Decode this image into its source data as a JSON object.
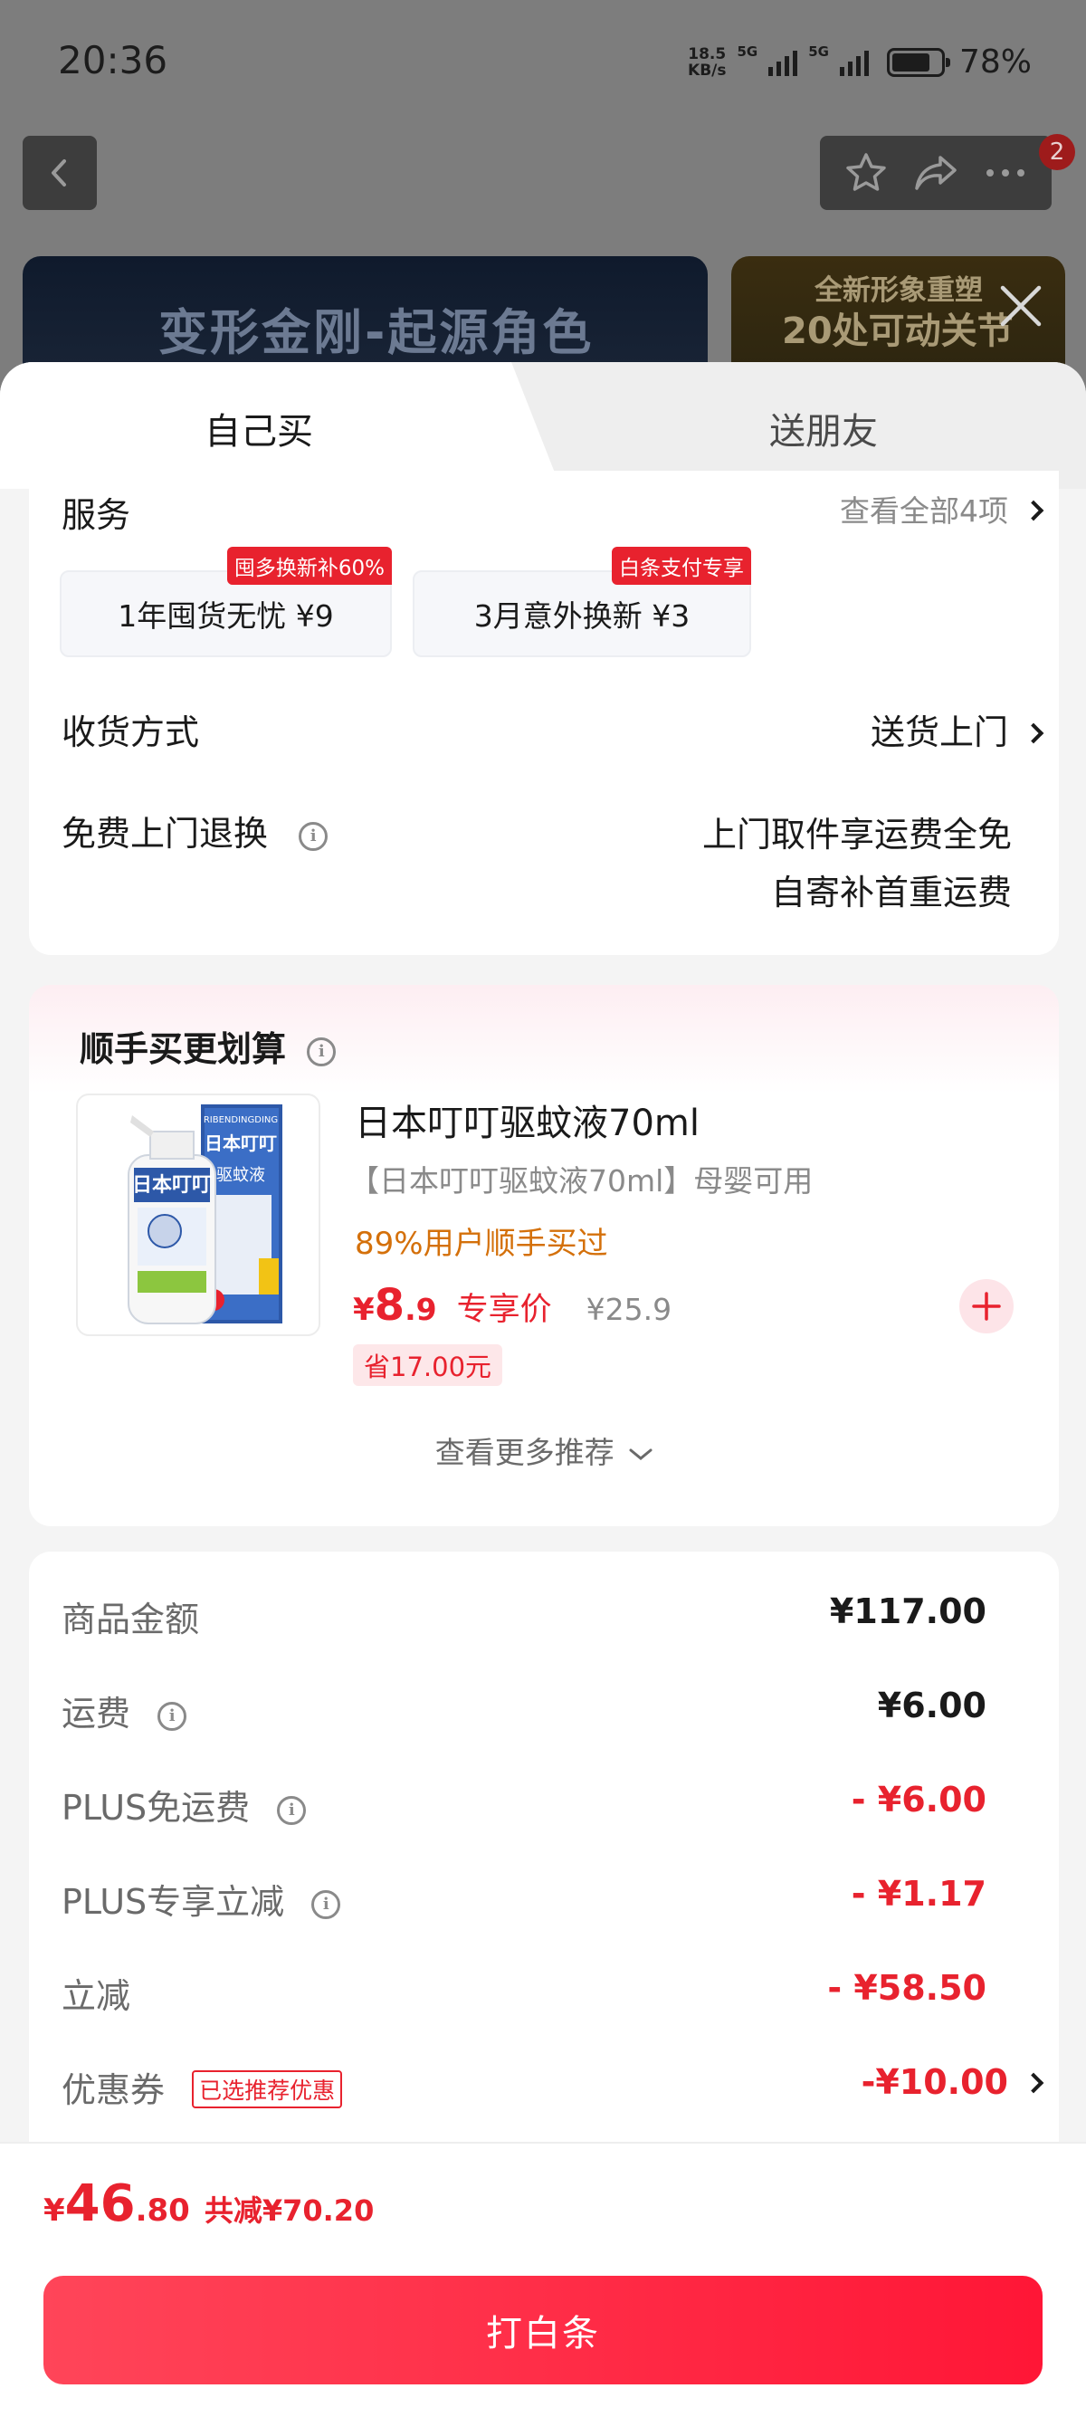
{
  "status_bar": {
    "time": "20:36",
    "net_speed_value": "18.5",
    "net_speed_unit": "KB/s",
    "signal1_label": "5G",
    "signal2_label": "5G",
    "battery_pct": "78%",
    "battery_level": 0.78
  },
  "nav": {
    "back_icon": "chevron-left-icon",
    "star_icon": "star-icon",
    "share_icon": "share-icon",
    "more_icon": "more-icon",
    "badge_count": "2"
  },
  "banners": {
    "left_title": "变形金刚-起源角色",
    "right_line1": "全新形象重塑",
    "right_line2": "20处可动关节"
  },
  "tabs": {
    "self": "自己买",
    "friend": "送朋友"
  },
  "services": {
    "title": "服务",
    "view_all": "查看全部4项",
    "items": [
      {
        "label": "1年囤货无忧  ¥9",
        "tag": "囤多换新补60%"
      },
      {
        "label": "3月意外换新  ¥3",
        "tag": "白条支付专享"
      }
    ]
  },
  "delivery": {
    "label": "收货方式",
    "value": "送货上门"
  },
  "free_return": {
    "label": "免费上门退换",
    "line1": "上门取件享运费全免",
    "line2": "自寄补首重运费"
  },
  "addon": {
    "title": "顺手买更划算",
    "product": {
      "name": "日本叮叮驱蚊液70ml",
      "subtitle": "【日本叮叮驱蚊液70ml】母婴可用",
      "buy_pct": "89%用户顺手买过",
      "price_symbol": "¥",
      "price_int": "8",
      "price_dec": ".9",
      "exclusive": "专享价",
      "original_price": "¥25.9",
      "save": "省17.00元",
      "pack_brand": "日本叮叮",
      "pack_brand_en": "RIBENDINGDING",
      "pack_type": "驱蚊液"
    },
    "more": "查看更多推荐"
  },
  "summary": {
    "rows": [
      {
        "label": "商品金额",
        "value": "¥117.00"
      },
      {
        "label": "运费",
        "value": "¥6.00"
      },
      {
        "label": "PLUS免运费",
        "value": "- ¥6.00"
      },
      {
        "label": "PLUS专享立减",
        "value": "- ¥1.17"
      },
      {
        "label": "立减",
        "value": "- ¥58.50"
      },
      {
        "label": "优惠券",
        "value": "-¥10.00",
        "tag": "已选推荐优惠"
      }
    ]
  },
  "footer": {
    "price_symbol": "¥",
    "price_int": "46",
    "price_dec": ".80",
    "total_saved": "共减¥70.20",
    "pay_button": "打白条"
  },
  "colors": {
    "accent_red": "#e8222e",
    "orange_text": "#d4700a",
    "button_gradient_start": "#ff4559",
    "button_gradient_end": "#ff1636"
  }
}
